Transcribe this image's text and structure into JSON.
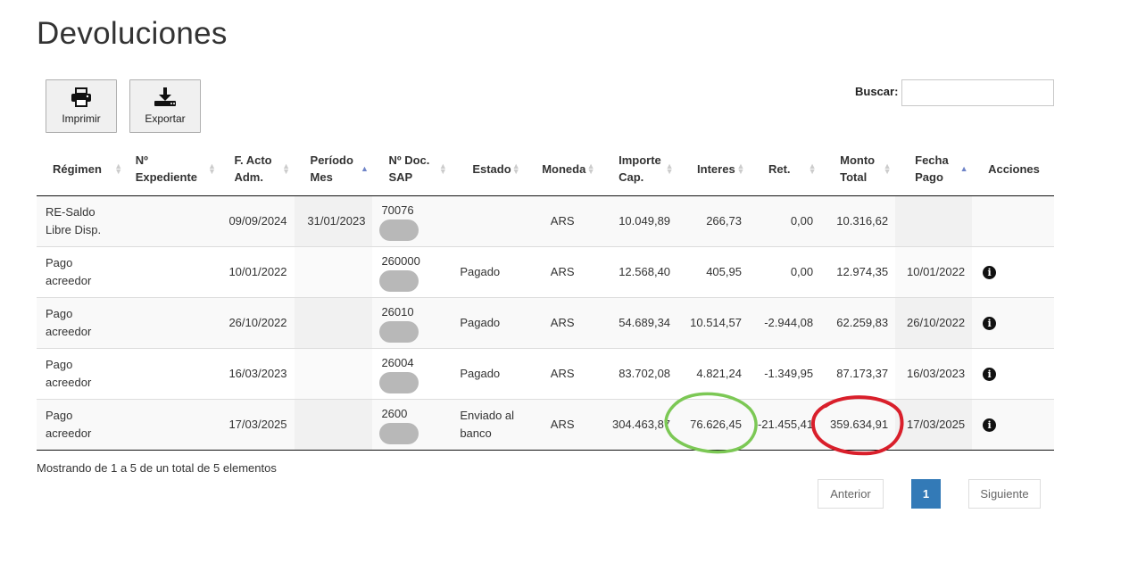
{
  "page": {
    "title": "Devoluciones"
  },
  "toolbar": {
    "print_label": "Imprimir",
    "export_label": "Exportar",
    "print_icon": "printer-icon",
    "export_icon": "download-icon"
  },
  "search": {
    "label": "Buscar:",
    "value": "",
    "placeholder": ""
  },
  "table": {
    "columns": [
      {
        "label": "Régimen",
        "sort": "none"
      },
      {
        "label": "Nº Expediente",
        "sort": "none"
      },
      {
        "label": "F. Acto Adm.",
        "sort": "none"
      },
      {
        "label": "Período Mes",
        "sort": "asc"
      },
      {
        "label": "Nº Doc. SAP",
        "sort": "none"
      },
      {
        "label": "Estado",
        "sort": "none"
      },
      {
        "label": "Moneda",
        "sort": "none"
      },
      {
        "label": "Importe Cap.",
        "sort": "none"
      },
      {
        "label": "Interes",
        "sort": "none"
      },
      {
        "label": "Ret.",
        "sort": "none"
      },
      {
        "label": "Monto Total",
        "sort": "none"
      },
      {
        "label": "Fecha Pago",
        "sort": "asc"
      },
      {
        "label": "Acciones",
        "sort": "none"
      }
    ],
    "rows": [
      {
        "regimen": "RE-Saldo Libre Disp.",
        "expediente": "",
        "fecha_acto": "09/09/2024",
        "periodo": "31/01/2023",
        "doc_sap": "70076",
        "estado": "",
        "moneda": "ARS",
        "importe": "10.049,89",
        "interes": "266,73",
        "ret": "0,00",
        "monto": "10.316,62",
        "fecha_pago": "",
        "action": ""
      },
      {
        "regimen": "Pago acreedor",
        "expediente": "",
        "fecha_acto": "10/01/2022",
        "periodo": "",
        "doc_sap": "260000",
        "estado": "Pagado",
        "moneda": "ARS",
        "importe": "12.568,40",
        "interes": "405,95",
        "ret": "0,00",
        "monto": "12.974,35",
        "fecha_pago": "10/01/2022",
        "action": "info-icon"
      },
      {
        "regimen": "Pago acreedor",
        "expediente": "",
        "fecha_acto": "26/10/2022",
        "periodo": "",
        "doc_sap": "26010",
        "estado": "Pagado",
        "moneda": "ARS",
        "importe": "54.689,34",
        "interes": "10.514,57",
        "ret": "-2.944,08",
        "monto": "62.259,83",
        "fecha_pago": "26/10/2022",
        "action": "info-icon"
      },
      {
        "regimen": "Pago acreedor",
        "expediente": "",
        "fecha_acto": "16/03/2023",
        "periodo": "",
        "doc_sap": "26004",
        "estado": "Pagado",
        "moneda": "ARS",
        "importe": "83.702,08",
        "interes": "4.821,24",
        "ret": "-1.349,95",
        "monto": "87.173,37",
        "fecha_pago": "16/03/2023",
        "action": "info-icon"
      },
      {
        "regimen": "Pago acreedor",
        "expediente": "",
        "fecha_acto": "17/03/2025",
        "periodo": "",
        "doc_sap": "2600",
        "estado": "Enviado al banco",
        "moneda": "ARS",
        "importe": "304.463,87",
        "interes": "76.626,45",
        "ret": "-21.455,41",
        "monto": "359.634,91",
        "fecha_pago": "17/03/2025",
        "action": "info-icon"
      }
    ]
  },
  "footer": {
    "info": "Mostrando de 1 a 5 de un total de 5 elementos"
  },
  "pagination": {
    "prev": "Anterior",
    "current": "1",
    "next": "Siguiente"
  },
  "annotations": {
    "green_circle_color": "#7cc855",
    "red_circle_color": "#d91f2b"
  },
  "colors": {
    "accent": "#337ab7",
    "sort_active": "#6f84c8"
  }
}
